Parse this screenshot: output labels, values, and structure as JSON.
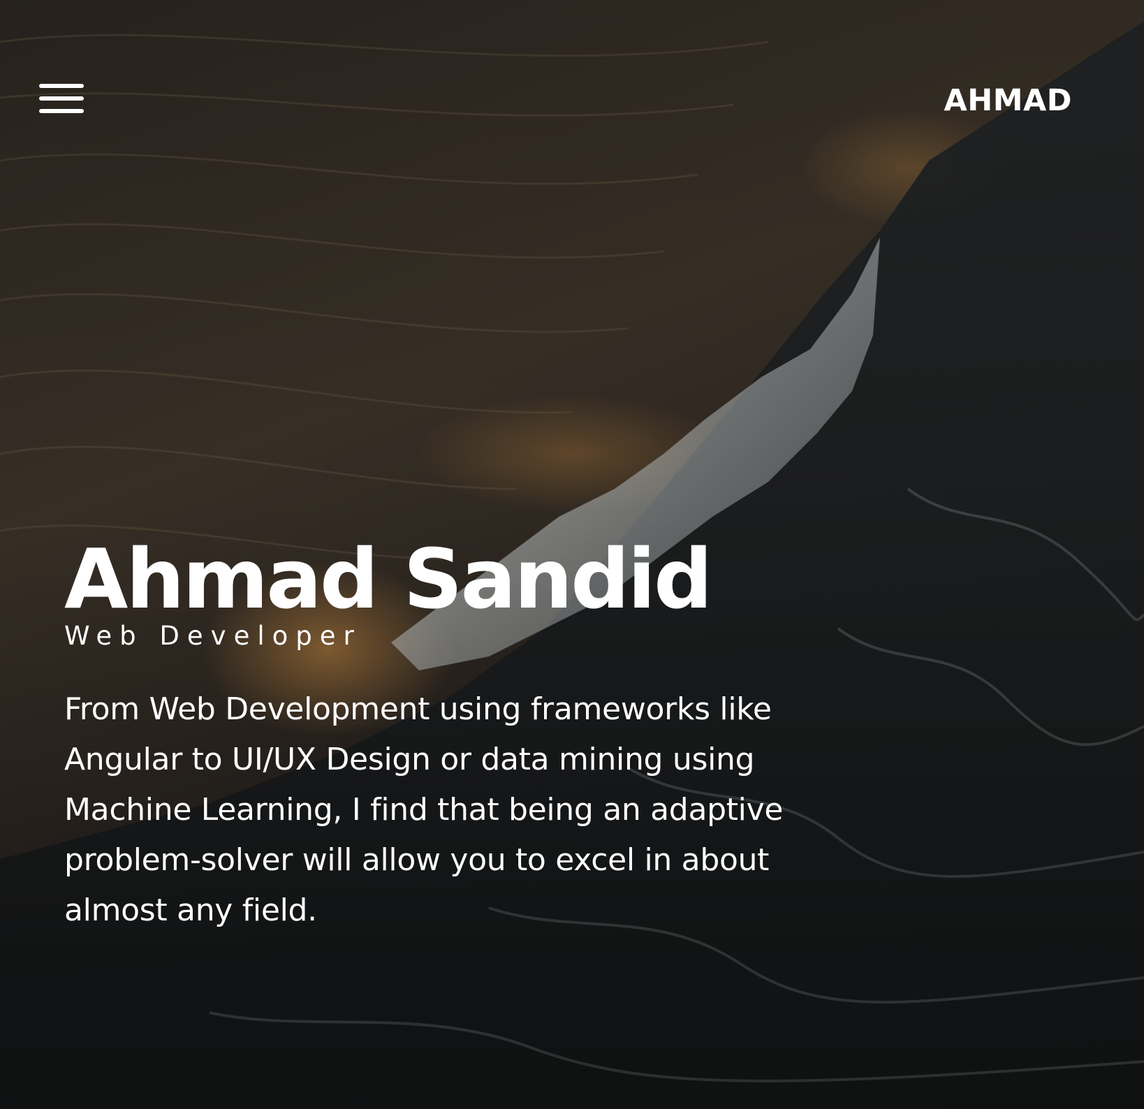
{
  "header": {
    "menu_icon": "hamburger-menu-icon",
    "brand": "AHMAD"
  },
  "hero": {
    "background": "ocean-wave-photo",
    "name": "Ahmad Sandid",
    "role": "Web Developer",
    "bio": "From Web Development using frameworks like Angular to UI/UX Design or data mining using Machine Learning, I find that being an adaptive problem-solver will allow you to excel in about almost any field."
  },
  "colors": {
    "text": "#ffffff",
    "background_dark": "#12100d",
    "highlight_gold": "#d69446"
  }
}
